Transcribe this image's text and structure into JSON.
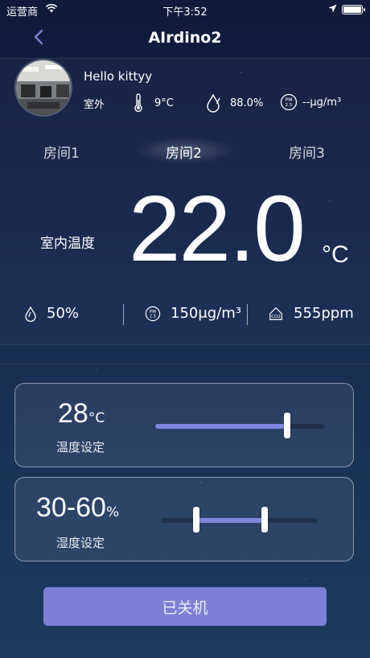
{
  "status_bar": {
    "carrier": "运营商",
    "time": "下午3:52"
  },
  "nav": {
    "title": "AIrdino2"
  },
  "outdoor": {
    "greeting": "Hello kittyy",
    "place": "室外",
    "temperature": "9°C",
    "humidity": "88.0%",
    "pm25": "--μg/m³",
    "pm_badge": "PM 2.5"
  },
  "rooms": [
    {
      "label": "房间1",
      "active": false
    },
    {
      "label": "房间2",
      "active": true
    },
    {
      "label": "房间3",
      "active": false
    }
  ],
  "indoor": {
    "label": "室内温度",
    "temperature": "22.0",
    "unit": "°C",
    "humidity": "50%",
    "pm25": "150μg/m³",
    "co2": "555ppm",
    "co2_badge": "CO2"
  },
  "controls": {
    "temperature": {
      "value": "28",
      "unit": "°C",
      "label": "温度设定",
      "level": 0.78
    },
    "humidity": {
      "value": "30-60",
      "unit": "%",
      "label": "湿度设定",
      "range": [
        0.3,
        0.6
      ]
    }
  },
  "power_button": {
    "label": "已关机"
  },
  "colors": {
    "accent": "#7b80d6",
    "slider_fill": "#7f86de"
  },
  "icons": [
    "back-chevron-icon",
    "wifi-icon",
    "location-arrow-icon",
    "battery-icon",
    "thermometer-icon",
    "water-drop-icon",
    "pm25-icon",
    "co2-icon"
  ]
}
